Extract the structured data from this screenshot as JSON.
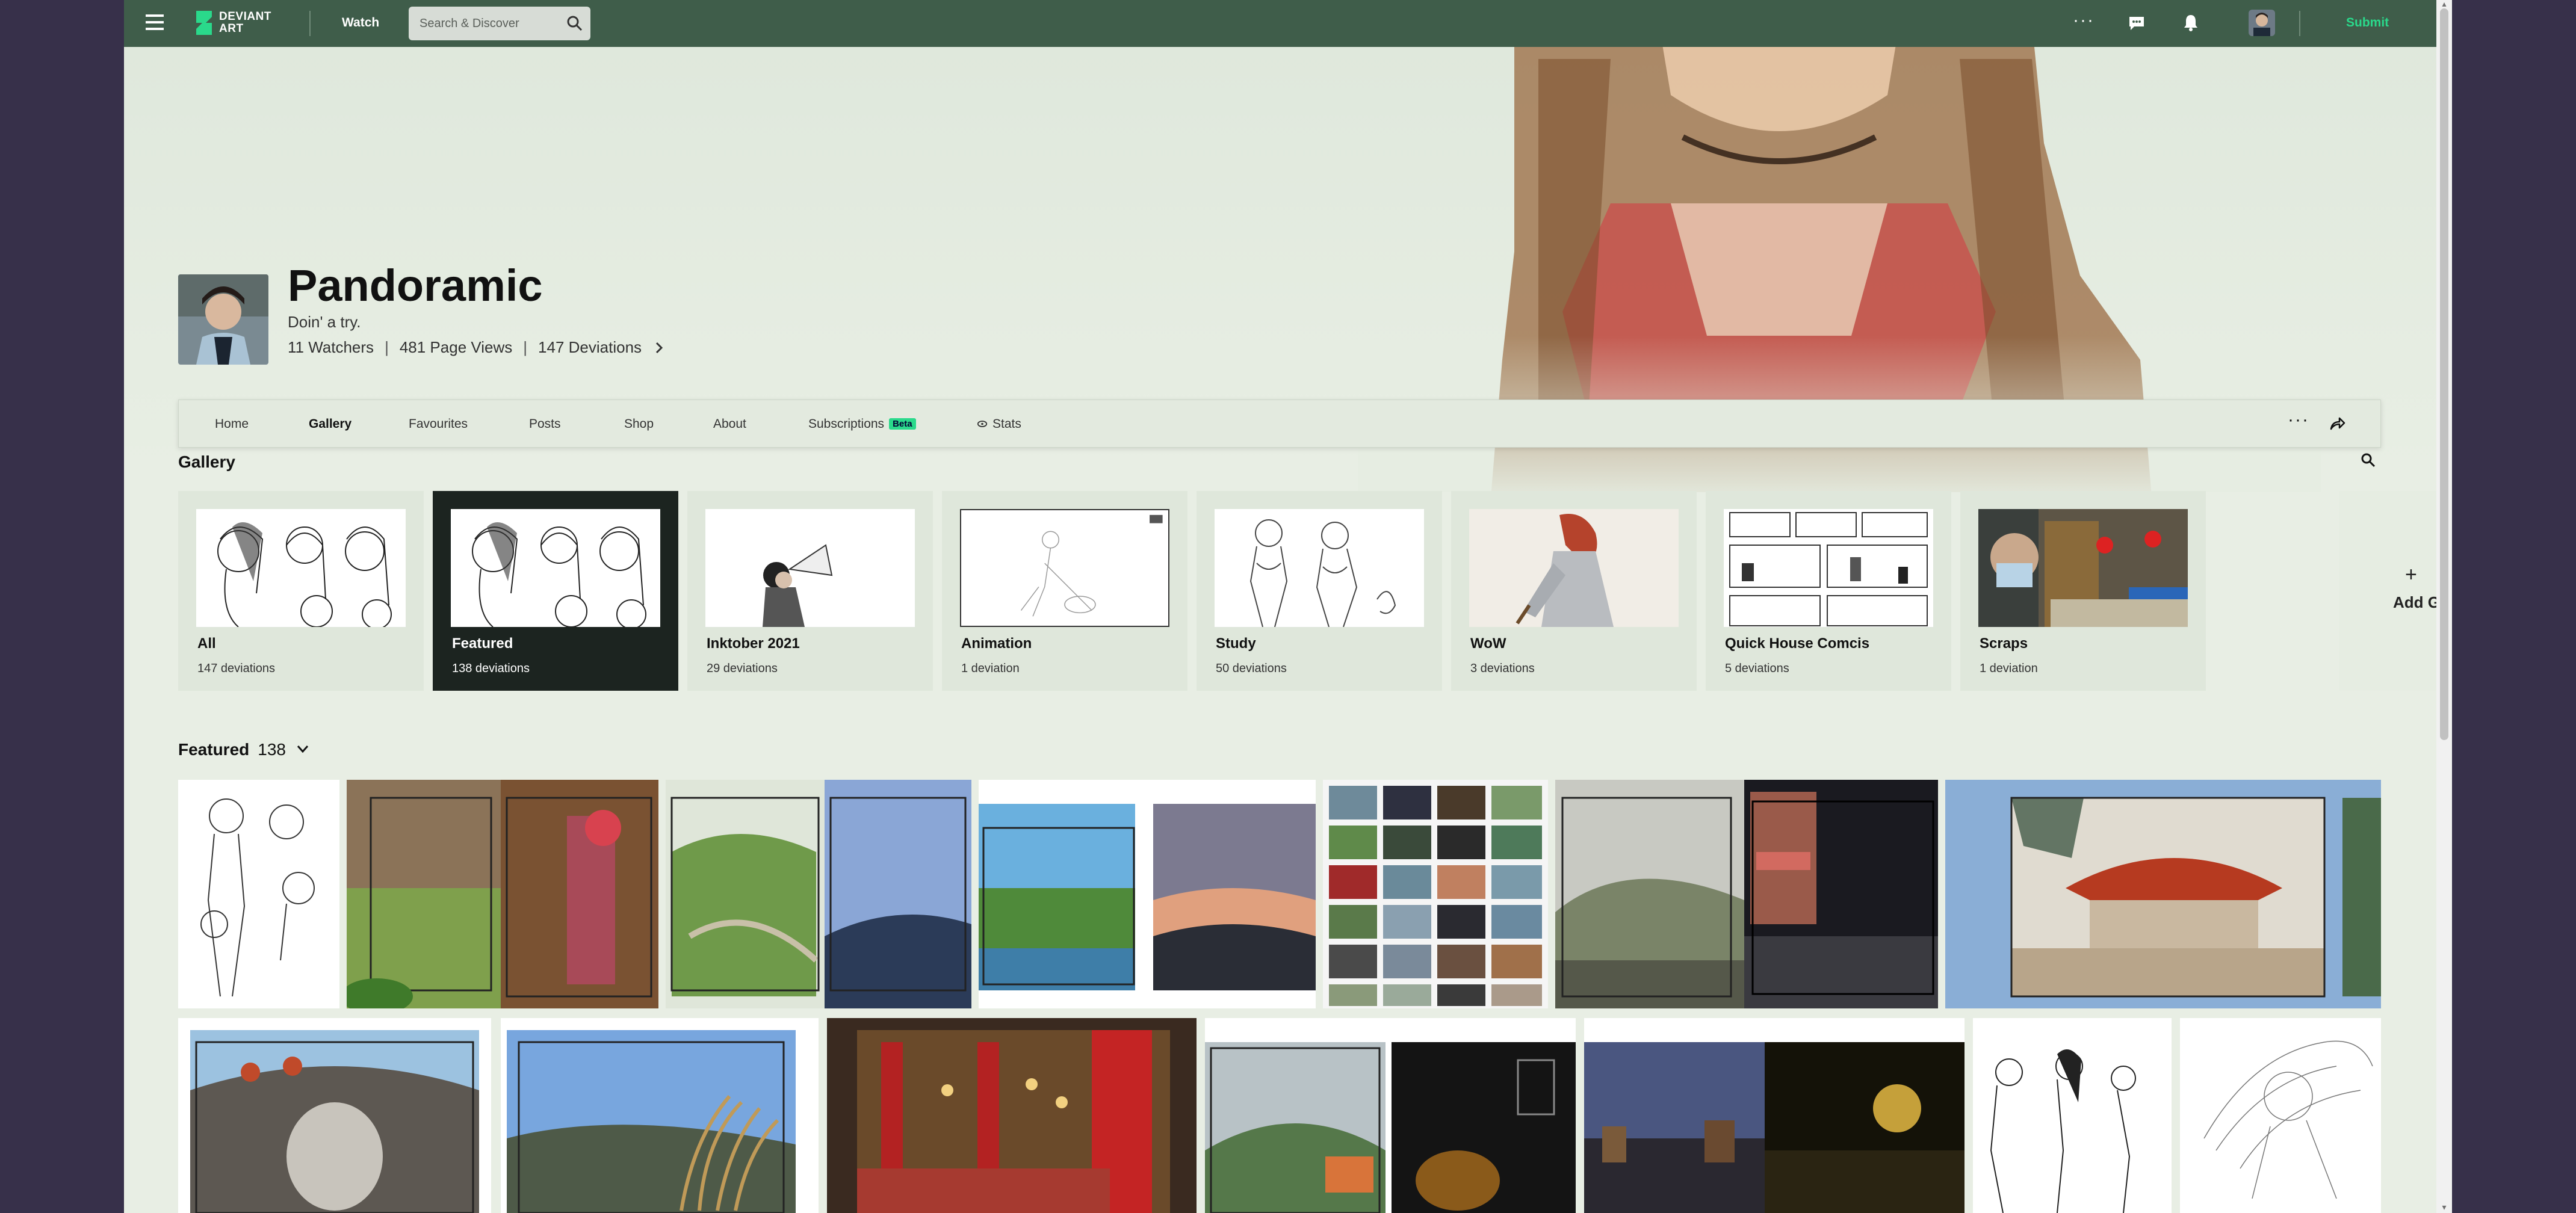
{
  "topbar": {
    "logo_text": "DEVIANT ART",
    "watch_label": "Watch",
    "search_placeholder": "Search & Discover",
    "submit_label": "Submit",
    "more_label": "···"
  },
  "profile": {
    "username": "Pandoramic",
    "tagline": "Doin' a try.",
    "watchers": "11 Watchers",
    "page_views": "481 Page Views",
    "deviations": "147 Deviations"
  },
  "tabs": {
    "home": "Home",
    "gallery": "Gallery",
    "favourites": "Favourites",
    "posts": "Posts",
    "shop": "Shop",
    "about": "About",
    "subscriptions": "Subscriptions",
    "beta": "Beta",
    "stats": "Stats",
    "more": "···"
  },
  "gallery": {
    "heading": "Gallery",
    "folders": [
      {
        "name": "All",
        "count": "147 deviations"
      },
      {
        "name": "Featured",
        "count": "138 deviations"
      },
      {
        "name": "Inktober 2021",
        "count": "29 deviations"
      },
      {
        "name": "Animation",
        "count": "1 deviation"
      },
      {
        "name": "Study",
        "count": "50 deviations"
      },
      {
        "name": "WoW",
        "count": "3 deviations"
      },
      {
        "name": "Quick House Comcis",
        "count": "5 deviations"
      },
      {
        "name": "Scraps",
        "count": "1 deviation"
      }
    ],
    "add_plus": "+",
    "add_label": "Add Gallery"
  },
  "featured": {
    "title": "Featured",
    "count": "138"
  },
  "colors": {
    "topbar_bg": "#3f5d4a",
    "accent_green": "#2ad98b",
    "page_bg": "#e8eee4",
    "active_folder_bg": "#1c2420",
    "outer_bg": "#37304a"
  }
}
